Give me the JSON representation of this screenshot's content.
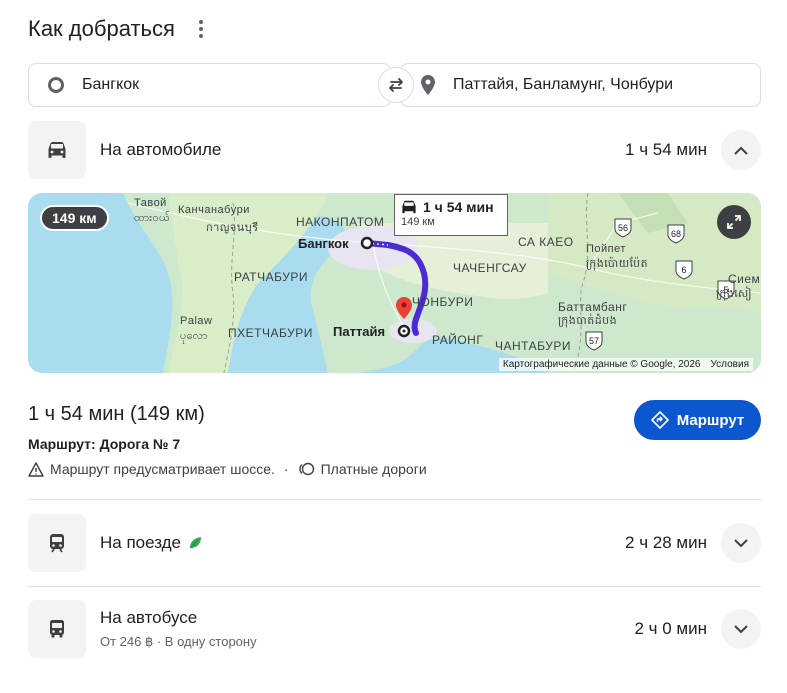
{
  "header": {
    "title": "Как добраться"
  },
  "inputs": {
    "origin": "Бангкок",
    "destination": "Паттайя, Банламунг, Чонбури"
  },
  "modes": {
    "car": {
      "label": "На автомобиле",
      "time": "1 ч 54 мин",
      "expanded": true
    },
    "train": {
      "label": "На поезде",
      "time": "2 ч 28 мин"
    },
    "bus": {
      "label": "На автобусе",
      "time": "2 ч 0 мин",
      "price": "От 246 ฿ · В одну сторону"
    }
  },
  "map": {
    "distance_pill": "149 км",
    "card_time": "1 ч 54 мин",
    "card_distance": "149 км",
    "attribution": "Картографические данные © Google, 2026",
    "terms": "Условия",
    "labels": {
      "tavoi": "Тавой",
      "tavoi_local": "ထားဝယ်",
      "kanchanaburi": "Канчанабури",
      "kanchanaburi_local": "กาญจนบุรี",
      "nakhonpathom": "НАКОНПАТОМ",
      "bangkok": "Бангкок",
      "sakaeo": "СА КАЕО",
      "poipet": "Пойпет",
      "poipet_local": "ក្រុងប៉ោយប៉ែត",
      "ratchaburi": "РАТЧАБУРИ",
      "chachoengsao": "ЧАЧЕНГСАУ",
      "siemreap": "Сиемр",
      "siemreap_local": "ក្រុងសៀ",
      "chonburi": "ЧОНБУРИ",
      "battambang": "Баттамбанг",
      "battambang_local": "ក្រុងបាត់ដំបង",
      "palaw": "Palaw",
      "palaw_local": "ပုလော",
      "phetchaburi": "ПХЕТЧАБУРИ",
      "pattaya": "Паттайя",
      "rayong": "РАЙОНГ",
      "chanthaburi": "ЧАНТАБУРИ",
      "shield_56": "56",
      "shield_68": "68",
      "shield_6": "6",
      "shield_5": "5",
      "shield_57": "57"
    }
  },
  "summary": {
    "title": "1 ч 54 мин (149 км)",
    "route": "Маршрут: Дорога № 7",
    "note_highway": "Маршрут предусматривает шоссе.",
    "separator": "·",
    "note_tolls": "Платные дороги"
  },
  "navigate_button": "Маршрут",
  "colors": {
    "route": "#4b2bd6",
    "accent": "#0b57d0",
    "pin": "#ea4335"
  }
}
